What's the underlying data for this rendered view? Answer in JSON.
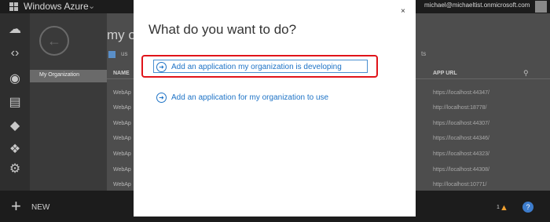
{
  "header": {
    "app_title": "Windows Azure",
    "user_email": "michael@michaeltist.onmicrosoft.com"
  },
  "subnav": {
    "selected": "My Organization"
  },
  "main": {
    "title_fragment": "my o",
    "subtitle_fragment": "us",
    "right_fragment": "ts",
    "columns": {
      "name": "NAME",
      "app_url": "APP URL"
    },
    "rows": [
      {
        "name": "WebAp",
        "url": "https://localhost:44347/"
      },
      {
        "name": "WebAp",
        "url": "http://localhost:18778/"
      },
      {
        "name": "WebAp",
        "url": "https://localhost:44307/"
      },
      {
        "name": "WebAp",
        "url": "https://localhost:44346/"
      },
      {
        "name": "WebAp",
        "url": "https://localhost:44323/"
      },
      {
        "name": "WebAp",
        "url": "https://localhost:44308/"
      },
      {
        "name": "WebAp",
        "url": "http://localhost:10771/"
      }
    ]
  },
  "dialog": {
    "heading": "What do you want to do?",
    "option1": "Add an application my organization is developing",
    "option2": "Add an application for my organization to use",
    "close_glyph": "×"
  },
  "bottom": {
    "new_label": "NEW",
    "alert_count": "1"
  },
  "colors": {
    "accent_blue": "#1e73c6",
    "highlight_red": "#e0141a",
    "green": "#3d9a3a"
  }
}
